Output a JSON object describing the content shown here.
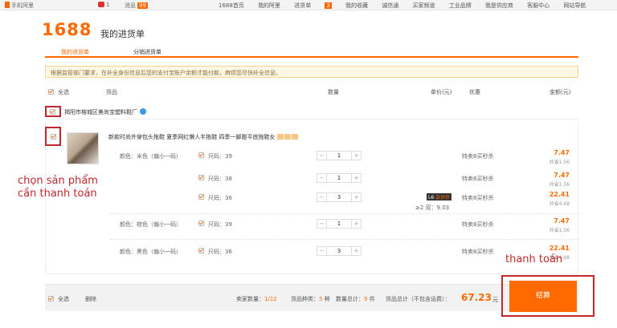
{
  "topbar": {
    "mobile": "手机阿里",
    "user_badge": "1",
    "messages_label": "消息",
    "messages_count": "99",
    "nav": [
      "1688首页",
      "我的阿里",
      "进货单",
      "我的收藏",
      "诚信通",
      "买家频道",
      "工业品牌",
      "我是供应商",
      "客服中心",
      "网站导航"
    ],
    "cart_count": "3"
  },
  "header": {
    "logo": "1688",
    "title": "我的进货单"
  },
  "tabs": [
    "我的进货单",
    "分销进货单"
  ],
  "notice": "根据监管部门要求，在补全身份信息后您的支付宝账户余额才能付款，麻烦您尽快补全信息。",
  "columns": {
    "select_all": "全选",
    "goods": "货品",
    "quantity": "数量",
    "unit_price": "单价(元)",
    "discount": "优惠",
    "amount": "金额(元)"
  },
  "shop": {
    "name": "揭阳市榕城区美尚宝塑料鞋厂"
  },
  "product": {
    "title": "新款时尚外穿包头拖鞋 夏季网红懒人半拖鞋 四季一脚蹬平底拖鞋女",
    "tier_badge_label": "L6",
    "tier_badge_value": "会员价",
    "tier_text": "≥2 双：9.03",
    "rows": [
      {
        "color": "颜色：米色（偏小一码）",
        "size": "尺码：39",
        "qty": "1",
        "promo": "特卖8买秒杀",
        "price": "7.47",
        "save": "共省1.56"
      },
      {
        "color": "",
        "size": "尺码：38",
        "qty": "1",
        "promo": "特卖8买秒杀",
        "price": "7.47",
        "save": "共省1.56"
      },
      {
        "color": "",
        "size": "尺码：36",
        "qty": "3",
        "promo": "特卖8买秒杀",
        "price": "22.41",
        "save": "共省4.68"
      },
      {
        "color": "颜色：棕色（偏小一码）",
        "size": "尺码：39",
        "qty": "1",
        "promo": "特卖8买秒杀",
        "price": "7.47",
        "save": "共省1.56"
      },
      {
        "color": "颜色：黑色（偏小一码）",
        "size": "尺码：36",
        "qty": "3",
        "promo": "特卖8买秒杀",
        "price": "22.41",
        "save": "共省4.68"
      }
    ]
  },
  "bottom": {
    "select_all": "全选",
    "delete": "删除",
    "sellers_label": "卖家数量：",
    "sellers_value": "1",
    "sellers_total": "/12",
    "kinds_label": "货品种类：",
    "kinds_value": "5",
    "kinds_unit": "种",
    "qty_label": "数量总计：",
    "qty_value": "9",
    "qty_unit": "件",
    "total_label": "货品总计（不包含运费）：",
    "total_value": "67.23",
    "currency": "元",
    "checkout": "结算"
  },
  "annotations": {
    "select_line1": "chọn sản phẩm",
    "select_line2": "cần thanh toán",
    "pay": "thanh toán"
  },
  "colors": {
    "accent": "#ff6a00",
    "annotation": "#c0282d"
  }
}
